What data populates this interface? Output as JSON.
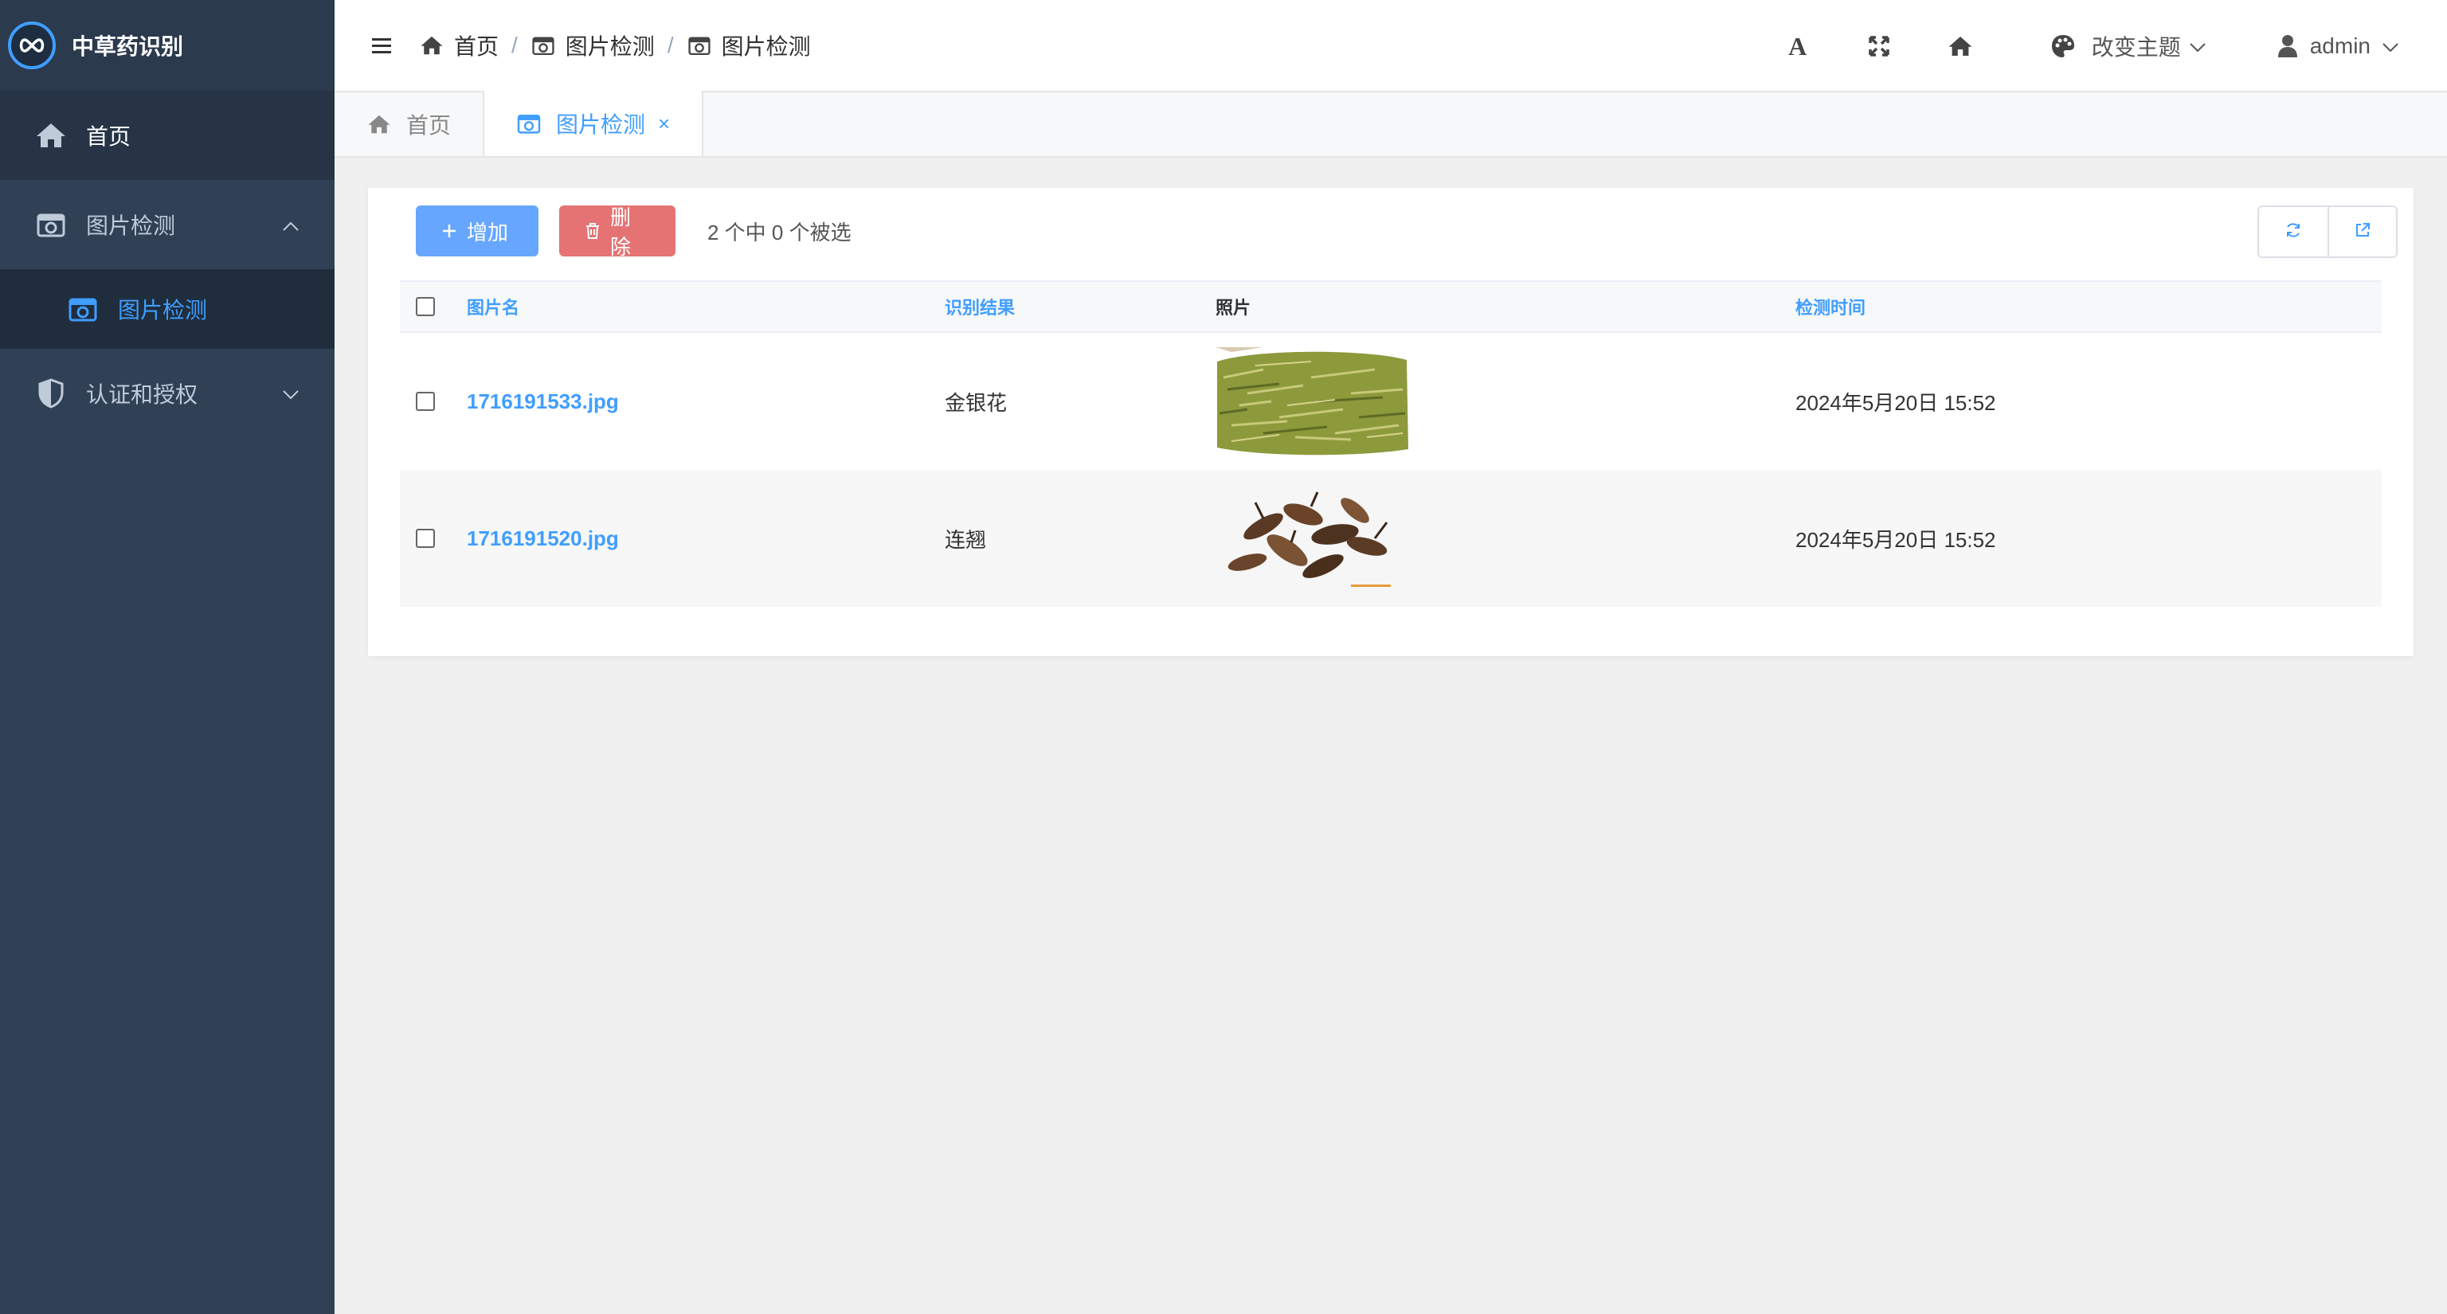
{
  "app": {
    "title": "中草药识别"
  },
  "sidebar": {
    "items": [
      {
        "label": "首页",
        "icon": "home-icon"
      },
      {
        "label": "图片检测",
        "icon": "camera-icon"
      },
      {
        "label": "图片检测",
        "icon": "camera-icon"
      },
      {
        "label": "认证和授权",
        "icon": "shield-icon"
      }
    ]
  },
  "breadcrumb": [
    "首页",
    "图片检测",
    "图片检测"
  ],
  "breadcrumb_sep": "/",
  "navbar": {
    "font_icon_label": "A",
    "theme_label": "改变主题",
    "user_label": "admin"
  },
  "tags": [
    {
      "label": "首页"
    },
    {
      "label": "图片检测",
      "close": "×"
    }
  ],
  "toolbar": {
    "add_label": "增加",
    "delete_label": "删除",
    "selection_info": "2 个中 0 个被选"
  },
  "table": {
    "columns": [
      "图片名",
      "识别结果",
      "照片",
      "检测时间"
    ],
    "rows": [
      {
        "name": "1716191533.jpg",
        "result": "金银花",
        "time": "2024年5月20日 15:52"
      },
      {
        "name": "1716191520.jpg",
        "result": "连翘",
        "time": "2024年5月20日 15:52"
      }
    ]
  },
  "colors": {
    "sidebar_bg": "#304156",
    "accent": "#409eff",
    "add_button": "#66a6ff",
    "delete_button": "#e57373"
  }
}
